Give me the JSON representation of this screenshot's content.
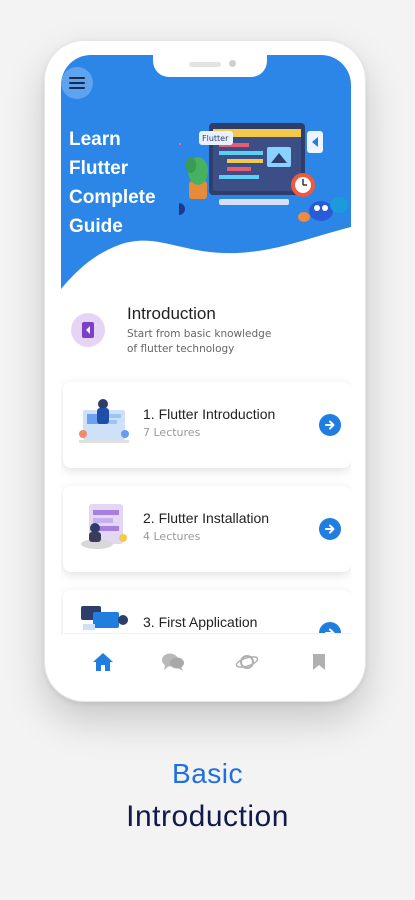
{
  "colors": {
    "primary": "#1f7ee0",
    "header_bg": "#2c86e8",
    "caption_accent": "#1f6fe0",
    "caption_dark": "#121a4a",
    "intro_icon_bg": "#e7d4f5"
  },
  "header": {
    "menu_icon": "hamburger-menu-icon",
    "title_line1": "Learn",
    "title_line2": "Flutter",
    "title_line3": "Complete",
    "title_line4": "Guide",
    "illustration_label": "Flutter"
  },
  "intro": {
    "icon": "chevron-left-icon",
    "title": "Introduction",
    "subtitle_line1": "Start from basic knowledge",
    "subtitle_line2": "of flutter technology"
  },
  "courses": [
    {
      "title": "1. Flutter Introduction",
      "subtitle": "7 Lectures",
      "icon": "arrow-right-circle-icon"
    },
    {
      "title": "2. Flutter Installation",
      "subtitle": "4 Lectures",
      "icon": "arrow-right-circle-icon"
    },
    {
      "title": "3. First Application",
      "subtitle": "",
      "icon": "arrow-right-circle-icon"
    }
  ],
  "bottom_nav": [
    {
      "icon": "home-icon",
      "active": true
    },
    {
      "icon": "chat-bubbles-icon",
      "active": false
    },
    {
      "icon": "planet-icon",
      "active": false
    },
    {
      "icon": "bookmark-icon",
      "active": false
    }
  ],
  "caption": {
    "line1": "Basic",
    "line2": "Introduction"
  }
}
